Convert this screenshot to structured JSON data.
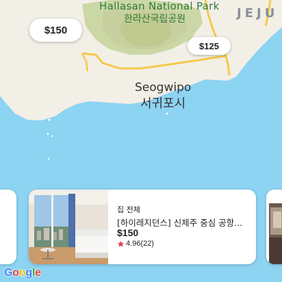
{
  "map": {
    "park_label_en": "Hallasan National Park",
    "park_label_ko": "한라산국립공원",
    "city_label_en": "Seogwipo",
    "city_label_ko": "서귀포시",
    "region_label": "JEJU",
    "colors": {
      "water": "#8dd3f2",
      "land": "#f2efe6",
      "park": "#cbd8a6",
      "road": "#f5c94a"
    }
  },
  "price_markers": [
    {
      "label": "$150"
    },
    {
      "label": "$125"
    }
  ],
  "listing_card": {
    "type": "집 전체",
    "title": "[하이레지던스] 신제주 중심 공항...",
    "price": "$150",
    "rating": "4.96(22)",
    "icon": "star-icon",
    "star_color": "#e8445a"
  },
  "attribution": {
    "logo_letters": [
      "G",
      "o",
      "o",
      "g",
      "l",
      "e"
    ]
  }
}
